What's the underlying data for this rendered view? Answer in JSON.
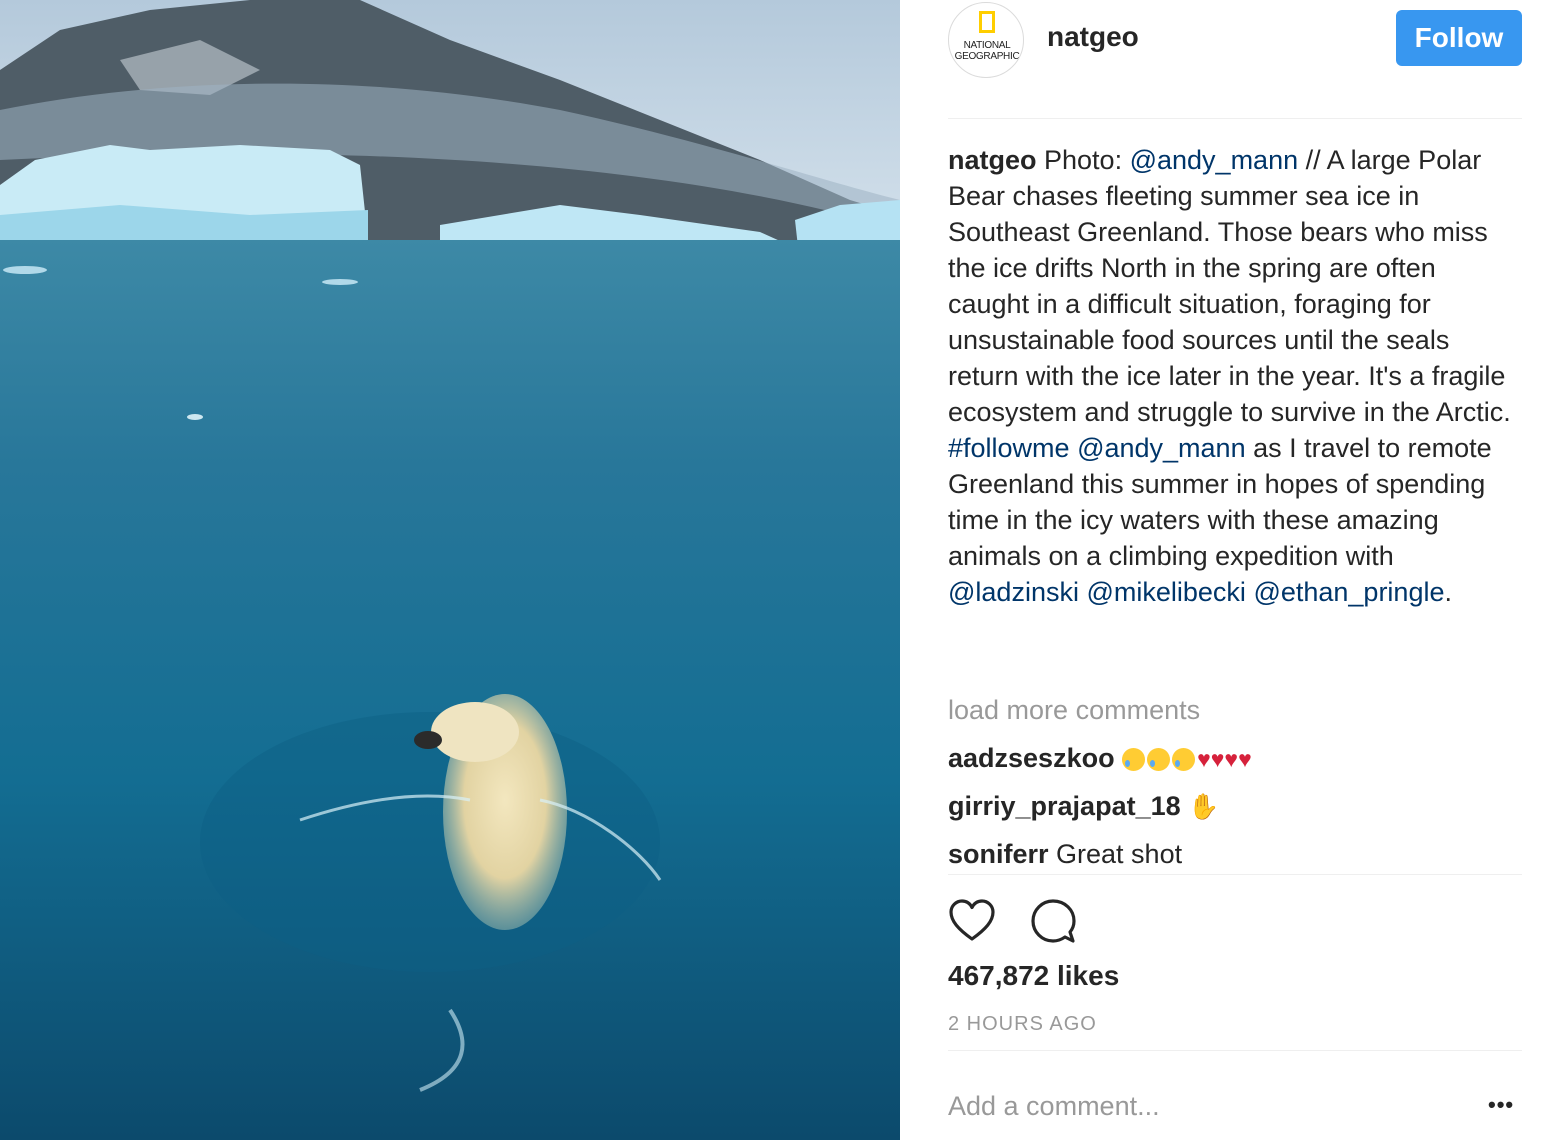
{
  "post": {
    "username": "natgeo",
    "follow_label": "Follow",
    "avatar_text": [
      "NATIONAL",
      "GEOGRAPHIC"
    ],
    "caption": {
      "user": "natgeo",
      "t1": " Photo: ",
      "m1": "@andy_mann",
      "t2": " // A large Polar Bear chases fleeting summer sea ice in Southeast Greenland. Those bears who miss the ice drifts North in the spring are often caught in a difficult situation, foraging for unsustainable food sources until the seals return with the ice later in the year. It's a fragile ecosystem and struggle to survive in the Arctic. ",
      "h1": "#followme",
      "sp": " ",
      "m2": "@andy_mann",
      "t3": " as I travel to remote Greenland this summer in hopes of spending time in the icy waters with these amazing animals on a climbing expedition with ",
      "m3": "@ladzinski",
      "sp2": " ",
      "m4": "@mikelibecki",
      "sp3": " ",
      "m5": "@ethan_pringle",
      "t4": "."
    },
    "load_more": "load more comments",
    "comments": [
      {
        "user": "aadzseszkoo",
        "text": ""
      },
      {
        "user": "girriy_prajapat_18",
        "text": ""
      },
      {
        "user": "soniferr",
        "text": " Great shot"
      }
    ],
    "likes": "467,872 likes",
    "time": "2 HOURS AGO",
    "add_comment_placeholder": "Add a comment...",
    "more_label": "•••"
  },
  "colors": {
    "accent": "#3897f0",
    "link": "#003569",
    "muted": "#999999",
    "text": "#262626"
  }
}
